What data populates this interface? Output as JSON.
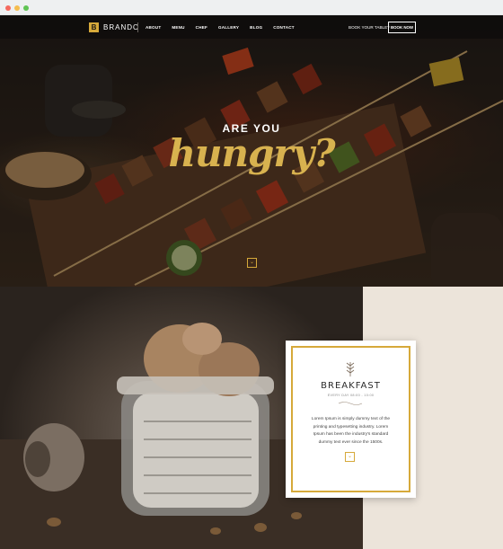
{
  "colors": {
    "accent": "#d6a93a",
    "hungry": "#d8b24f",
    "nav_bg": "#0f0d0c",
    "panel_beige": "#ece4da",
    "browser_dot_red": "#f56a5f",
    "browser_dot_yellow": "#f5bd4f",
    "browser_dot_green": "#5fc454"
  },
  "brand": {
    "mark": "B",
    "name": "BRANDO"
  },
  "nav": {
    "items": [
      "ABOUT",
      "MENU",
      "CHEF",
      "GALLERY",
      "BLOG",
      "CONTACT"
    ],
    "book_table_label": "BOOK YOUR TABLE?",
    "book_now_label": "BOOK NOW"
  },
  "hero": {
    "kicker": "ARE YOU",
    "headline": "hungry?",
    "scroll_icon": "chevron-down-icon",
    "scroll_glyph": "⌄"
  },
  "card": {
    "icon": "wheat-icon",
    "title": "BREAKFAST",
    "subtitle": "EVERY DAY 08:00 - 10:00",
    "text": "Lorem Ipsum is simply dummy text of the printing and typesetting industry. Lorem Ipsum has been the industry's standard dummy text ever since the 1500s.",
    "button_icon": "chevron-down-icon",
    "button_glyph": "⌄"
  }
}
